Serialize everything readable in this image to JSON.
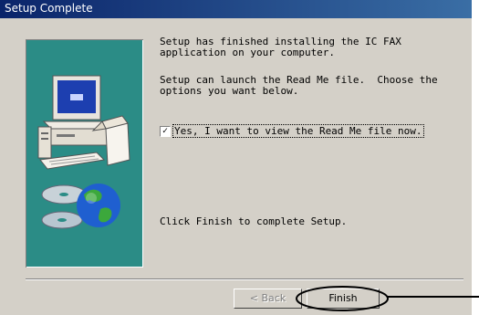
{
  "window": {
    "title": "Setup Complete"
  },
  "messages": {
    "finished": "Setup has finished installing the IC FAX\napplication on your computer.",
    "readme_prompt": "Setup can launch the Read Me file.  Choose the\noptions you want below.",
    "finish_hint": "Click Finish to complete Setup."
  },
  "readme_checkbox": {
    "label": "Yes, I want to view the Read Me file now.",
    "checked": true,
    "mark": "✓"
  },
  "buttons": {
    "back_label": "< Back",
    "finish_label": "Finish"
  },
  "colors": {
    "side_panel": "#2b8c86",
    "titlebar": "#0a246a",
    "annotation": "#000000"
  },
  "icons": [
    "computer-icon",
    "cd-disc-icon",
    "globe-icon",
    "package-box-icon"
  ]
}
